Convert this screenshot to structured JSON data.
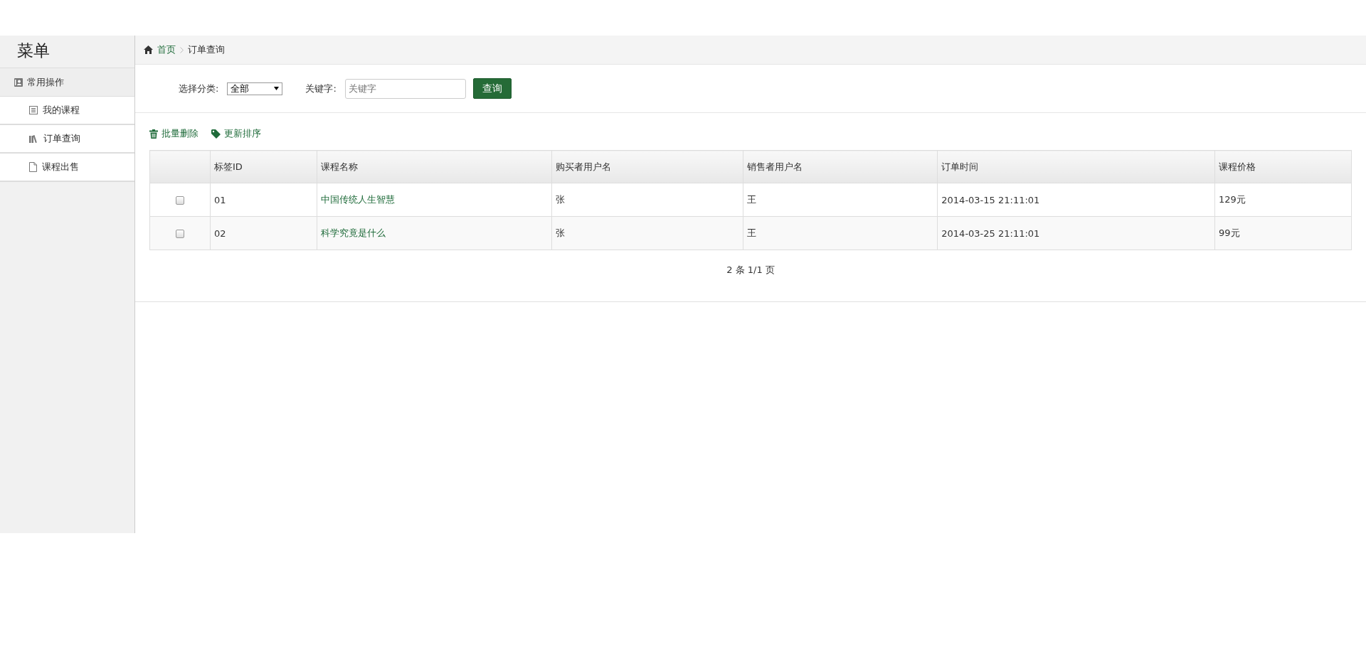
{
  "sidebar": {
    "title": "菜单",
    "groups": [
      {
        "label": "常用操作",
        "items": [
          {
            "label": "我的课程",
            "kind": "list"
          },
          {
            "label": "订单查询",
            "kind": "books"
          },
          {
            "label": "课程出售",
            "kind": "file"
          }
        ]
      }
    ]
  },
  "breadcrumb": {
    "home": "首页",
    "current": "订单查询"
  },
  "filter": {
    "category_label": "选择分类:",
    "category_value": "全部",
    "keyword_label": "关键字:",
    "keyword_placeholder": "关键字",
    "submit": "查询"
  },
  "toolbar": [
    {
      "label": "批量删除",
      "kind": "trash"
    },
    {
      "label": "更新排序",
      "kind": "tag"
    }
  ],
  "table": {
    "columns": [
      "",
      "标签ID",
      "课程名称",
      "购买者用户名",
      "销售者用户名",
      "订单时间",
      "课程价格"
    ],
    "rows": [
      {
        "checked": false,
        "cells": [
          "",
          "01",
          "中国传统人生智慧",
          "张",
          "王",
          "2014-03-15 21:11:01",
          "129元"
        ]
      },
      {
        "checked": false,
        "cells": [
          "",
          "02",
          "科学究竟是什么",
          "张",
          "王",
          "2014-03-25 21:11:01",
          "99元"
        ]
      }
    ]
  },
  "pagination": "2 条 1/1 页"
}
